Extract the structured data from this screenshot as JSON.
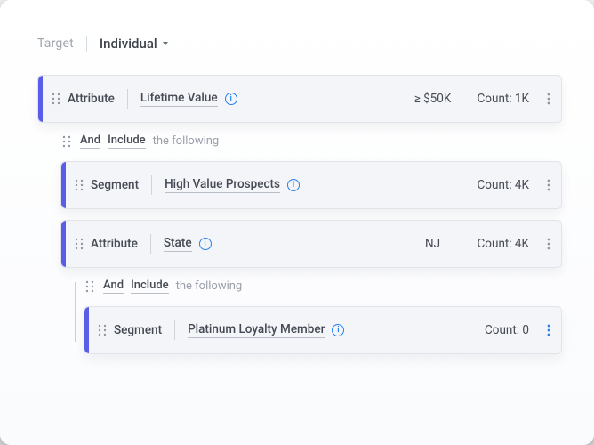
{
  "header": {
    "target_label": "Target",
    "type": "Individual"
  },
  "rows": [
    {
      "kind": "Attribute",
      "value": "Lifetime Value",
      "op": "≥ $50K",
      "count": "Count: 1K"
    }
  ],
  "group1": {
    "op": "And",
    "mode": "Include",
    "rest": "the following",
    "rows": [
      {
        "kind": "Segment",
        "value": "High Value Prospects",
        "op": "",
        "count": "Count: 4K"
      },
      {
        "kind": "Attribute",
        "value": "State",
        "op": "NJ",
        "count": "Count: 4K"
      }
    ],
    "group2": {
      "op": "And",
      "mode": "Include",
      "rest": "the following",
      "rows": [
        {
          "kind": "Segment",
          "value": "Platinum Loyalty Member",
          "op": "",
          "count": "Count: 0"
        }
      ]
    }
  }
}
